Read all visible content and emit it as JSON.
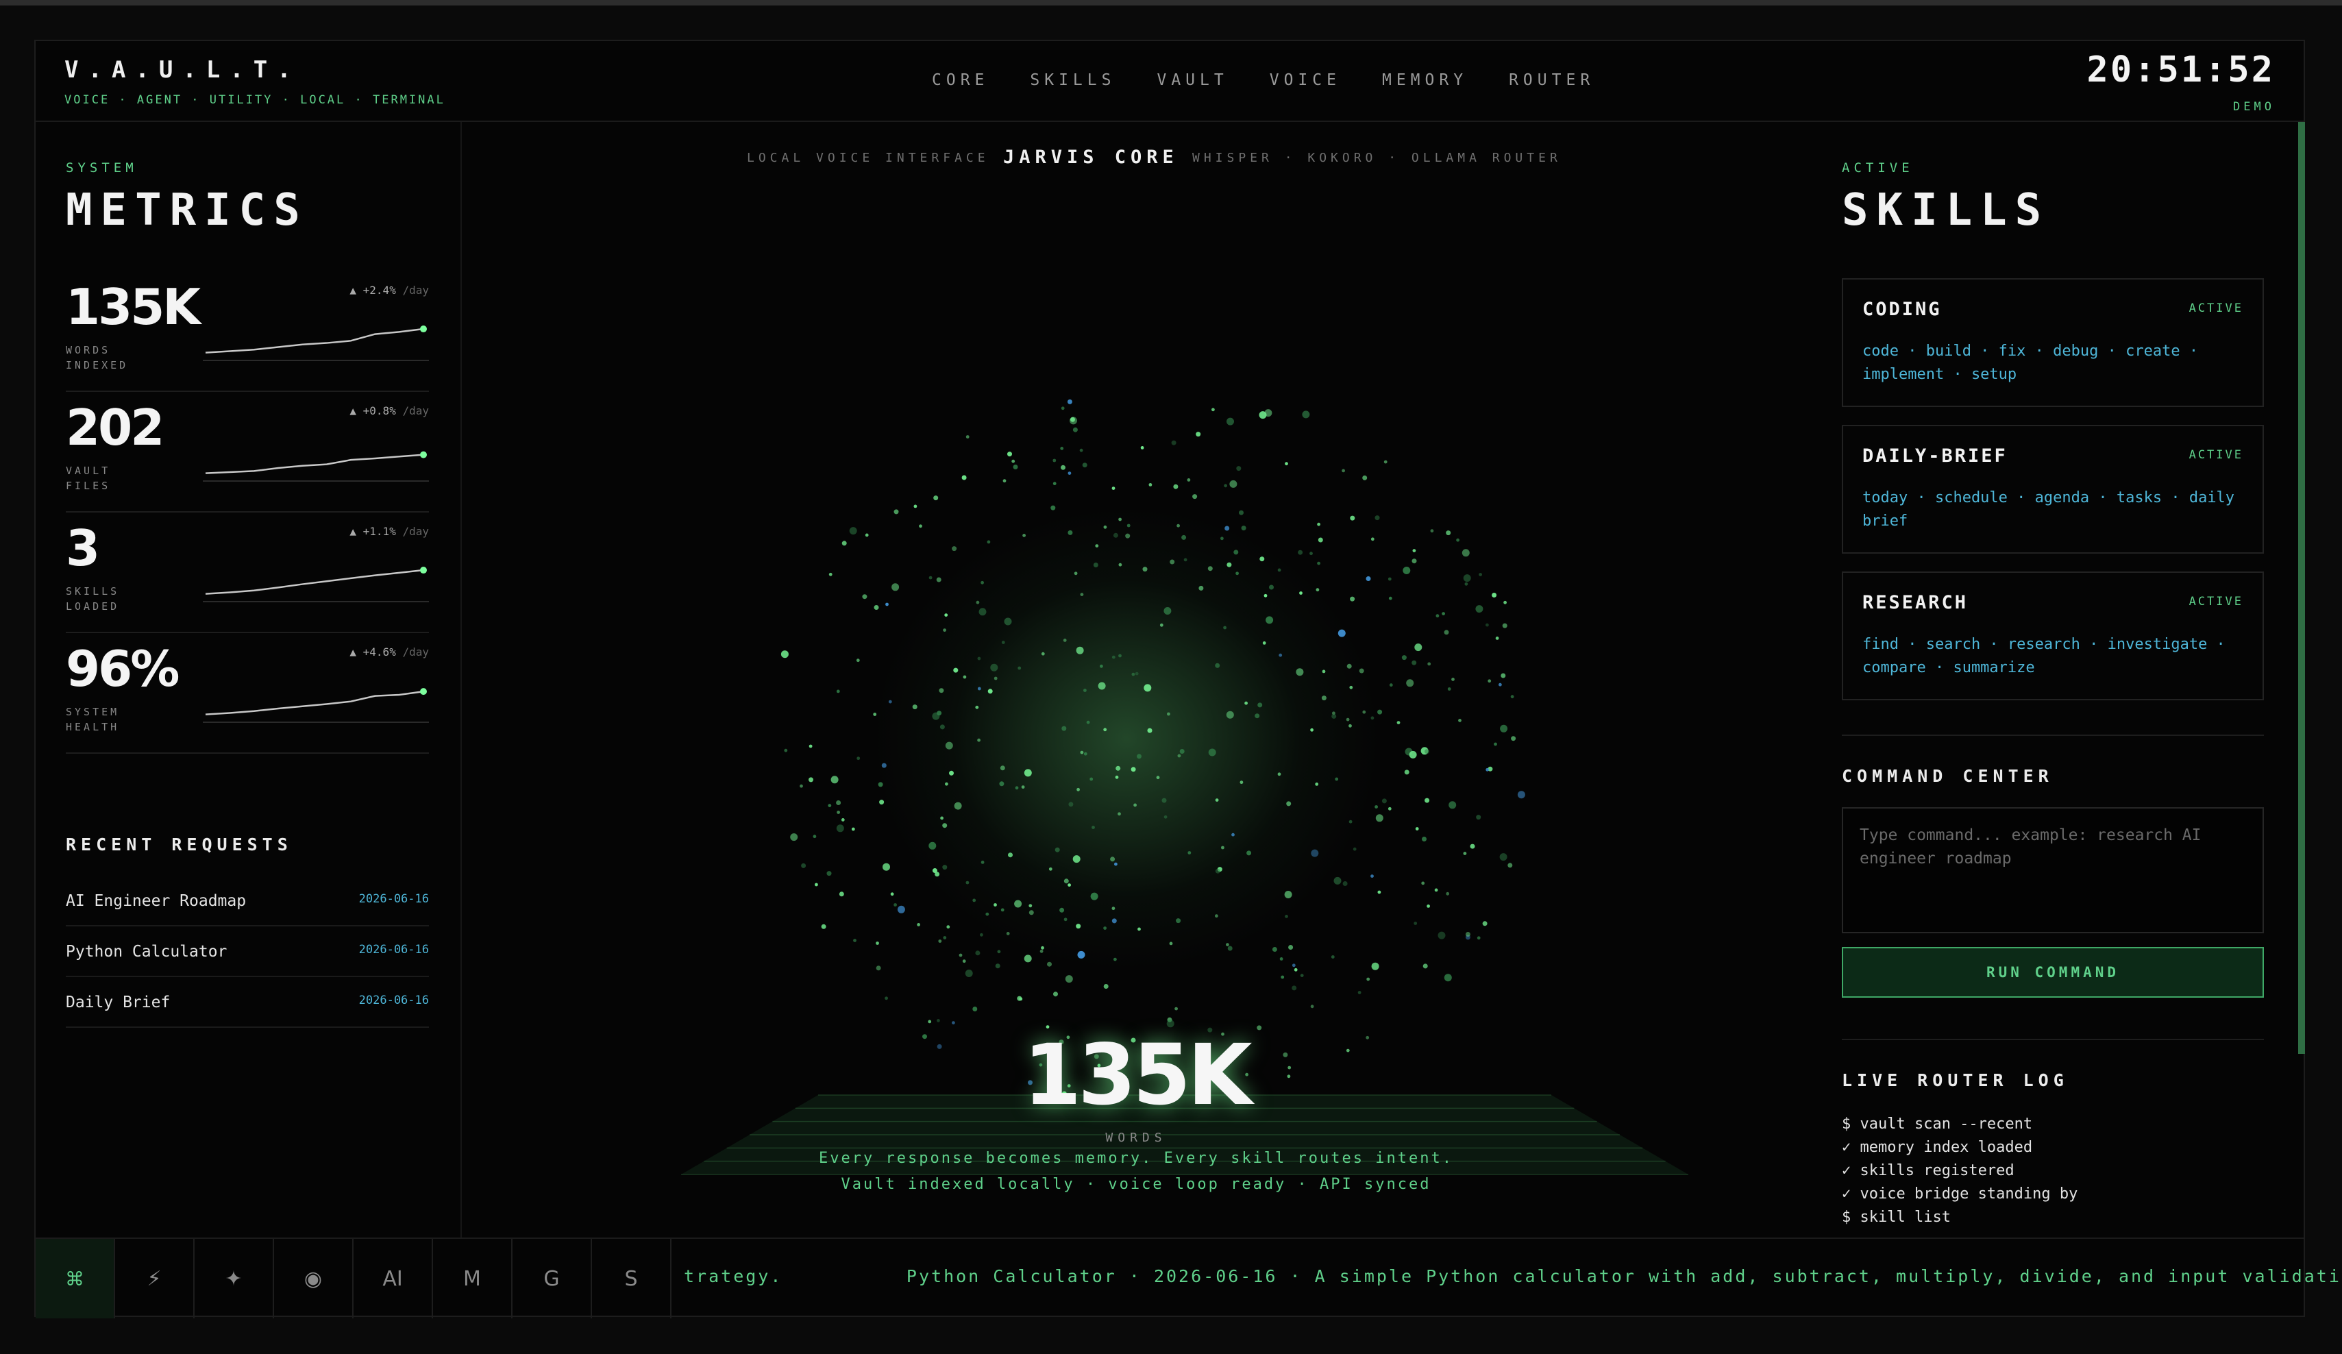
{
  "header": {
    "brand": "V.A.U.L.T.",
    "tagline": "VOICE · AGENT · UTILITY · LOCAL · TERMINAL",
    "nav": [
      "CORE",
      "SKILLS",
      "VAULT",
      "VOICE",
      "MEMORY",
      "ROUTER"
    ],
    "clock": "20:51:52",
    "mode": "DEMO"
  },
  "metrics": {
    "kicker": "SYSTEM",
    "title": "METRICS",
    "items": [
      {
        "value": "135K",
        "label": "WORDS INDEXED",
        "delta": "▲ +2.4%",
        "per": "/day",
        "trend": [
          0.1,
          0.14,
          0.18,
          0.25,
          0.32,
          0.36,
          0.42,
          0.6,
          0.66,
          0.74
        ]
      },
      {
        "value": "202",
        "label": "VAULT FILES",
        "delta": "▲ +0.8%",
        "per": "/day",
        "trend": [
          0.1,
          0.13,
          0.16,
          0.24,
          0.3,
          0.34,
          0.46,
          0.5,
          0.55,
          0.6
        ]
      },
      {
        "value": "3",
        "label": "SKILLS LOADED",
        "delta": "▲ +1.1%",
        "per": "/day",
        "trend": [
          0.1,
          0.14,
          0.19,
          0.27,
          0.36,
          0.44,
          0.52,
          0.6,
          0.67,
          0.74
        ]
      },
      {
        "value": "96%",
        "label": "SYSTEM HEALTH",
        "delta": "▲ +4.6%",
        "per": "/day",
        "trend": [
          0.1,
          0.14,
          0.19,
          0.26,
          0.32,
          0.38,
          0.45,
          0.6,
          0.63,
          0.72
        ]
      }
    ]
  },
  "requests": {
    "title": "RECENT REQUESTS",
    "items": [
      {
        "name": "AI Engineer Roadmap",
        "date": "2026-06-16"
      },
      {
        "name": "Python Calculator",
        "date": "2026-06-16"
      },
      {
        "name": "Daily Brief",
        "date": "2026-06-16"
      }
    ]
  },
  "core": {
    "left": "LOCAL VOICE INTERFACE",
    "title": "JARVIS CORE",
    "right": "WHISPER · KOKORO · OLLAMA ROUTER",
    "big_value": "135K",
    "big_label": "WORDS",
    "line1": "Every response becomes memory. Every skill routes intent.",
    "line2": "Vault indexed locally · voice loop ready · API synced"
  },
  "skills": {
    "kicker": "ACTIVE",
    "title": "SKILLS",
    "items": [
      {
        "name": "CODING",
        "status": "ACTIVE",
        "keywords": "code · build · fix · debug · create · implement · setup"
      },
      {
        "name": "DAILY-BRIEF",
        "status": "ACTIVE",
        "keywords": "today · schedule · agenda · tasks · daily brief"
      },
      {
        "name": "RESEARCH",
        "status": "ACTIVE",
        "keywords": "find · search · research · investigate · compare · summarize"
      }
    ]
  },
  "command": {
    "title": "COMMAND CENTER",
    "placeholder": "Type command... example: research AI engineer roadmap",
    "button": "RUN COMMAND"
  },
  "log": {
    "title": "LIVE ROUTER LOG",
    "lines": [
      "$ vault scan --recent",
      "✓ memory index loaded",
      "✓ skills registered",
      "✓ voice bridge standing by",
      "$ skill list"
    ]
  },
  "dock": [
    "⌘",
    "⚡",
    "✦",
    "◉",
    "AI",
    "M",
    "G",
    "S"
  ],
  "ticker": "trategy.          Python Calculator · 2026-06-16 · A simple Python calculator with add, subtract, multiply, divide, and input validation.",
  "colors": {
    "accent": "#5fd08a",
    "link": "#4eb6d8",
    "background": "#050505"
  },
  "icons": [
    "command-icon",
    "bolt-icon",
    "sparkle-icon",
    "target-icon"
  ]
}
